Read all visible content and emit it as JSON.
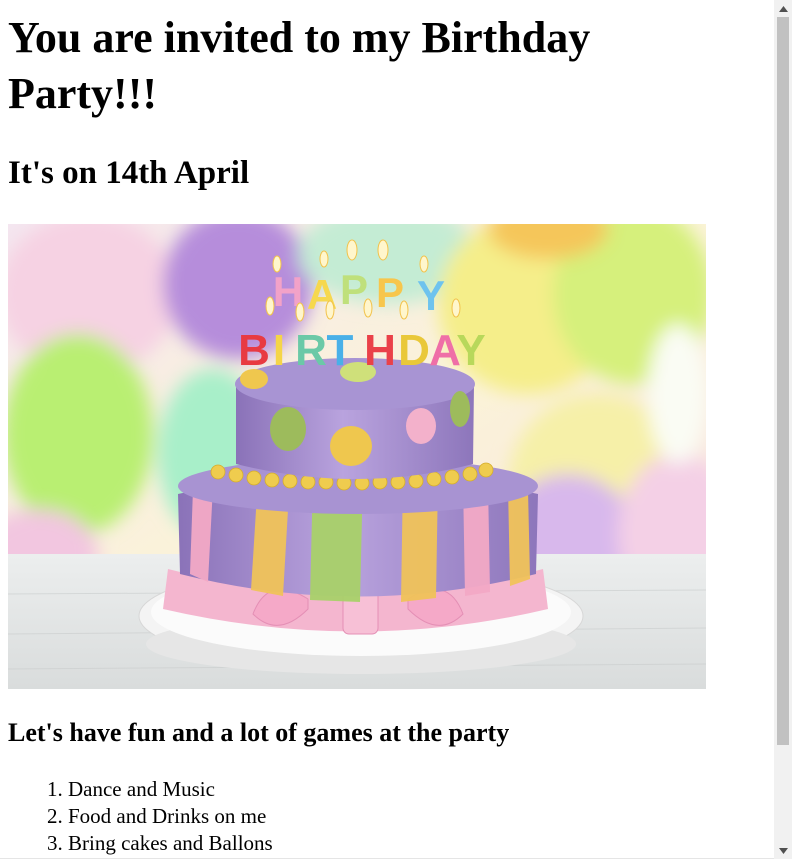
{
  "page": {
    "heading": "You are invited to my Birthday Party!!!",
    "subheading": "It's on 14th April",
    "photo": {
      "name": "birthday-cake-photo",
      "alt": "Birthday cake with Happy Birthday candles in front of balloons",
      "candles_top": "HAPPY",
      "candles_bottom": "BIRTHDAY"
    },
    "tagline": "Let's have fun and a lot of games at the party",
    "list": [
      "Dance and Music",
      "Food and Drinks on me",
      "Bring cakes and Ballons"
    ]
  },
  "scrollbar": {
    "up_icon": "arrow-up-icon",
    "down_icon": "arrow-down-icon"
  }
}
